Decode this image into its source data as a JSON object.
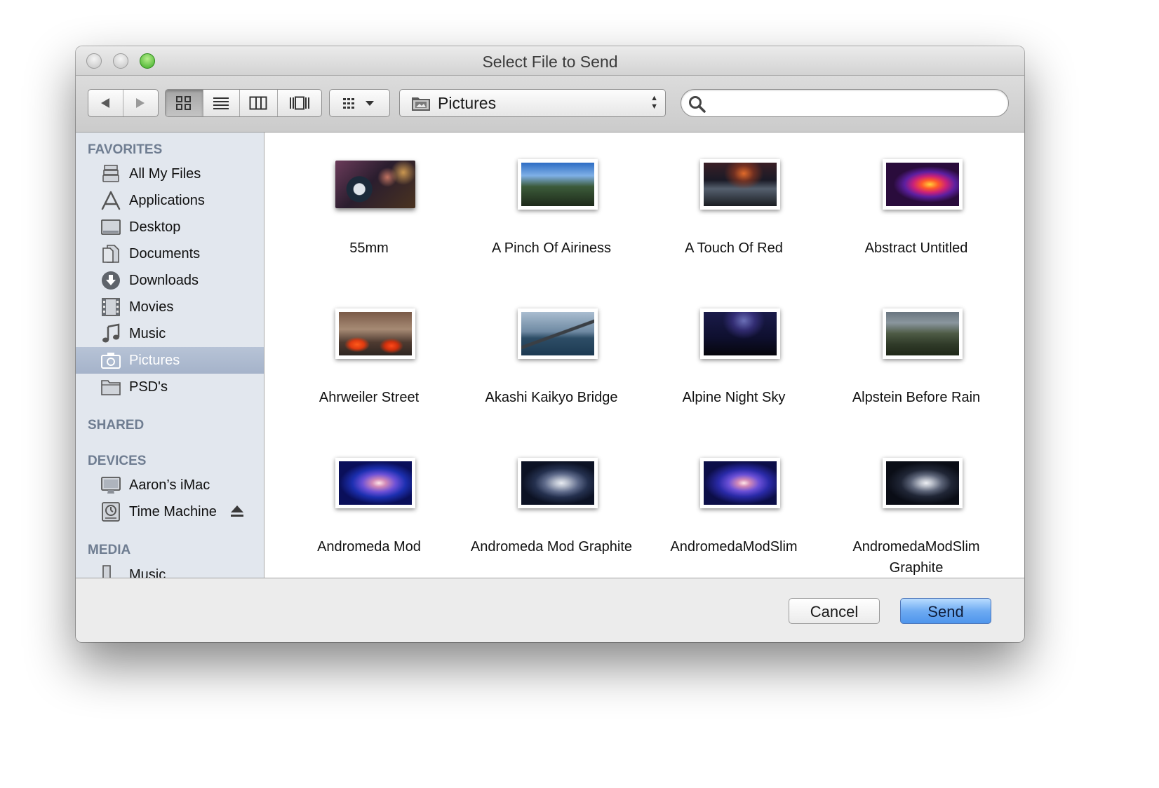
{
  "window": {
    "title": "Select File to Send"
  },
  "toolbar": {
    "back_icon": "back-arrow-icon",
    "forward_icon": "forward-arrow-icon",
    "view_modes": [
      "icon-view",
      "list-view",
      "column-view",
      "cover-flow-view"
    ],
    "active_view": "icon-view",
    "arrange_icon": "arrange-grid-icon",
    "location": "Pictures",
    "search": {
      "value": "",
      "placeholder": ""
    }
  },
  "sidebar": {
    "favorites_header": "FAVORITES",
    "favorites": [
      {
        "label": "All My Files",
        "icon": "all-my-files-icon"
      },
      {
        "label": "Applications",
        "icon": "applications-icon"
      },
      {
        "label": "Desktop",
        "icon": "desktop-icon"
      },
      {
        "label": "Documents",
        "icon": "documents-icon"
      },
      {
        "label": "Downloads",
        "icon": "downloads-icon"
      },
      {
        "label": "Movies",
        "icon": "movies-icon"
      },
      {
        "label": "Music",
        "icon": "music-icon"
      },
      {
        "label": "Pictures",
        "icon": "pictures-icon",
        "selected": true
      },
      {
        "label": "PSD's",
        "icon": "folder-icon"
      }
    ],
    "shared_header": "SHARED",
    "devices_header": "DEVICES",
    "devices": [
      {
        "label": "Aaron’s iMac",
        "icon": "imac-icon"
      },
      {
        "label": "Time Machine",
        "icon": "time-machine-icon",
        "ejectable": true
      }
    ],
    "media_header": "MEDIA",
    "media": [
      {
        "label": "Music",
        "icon": "music-folder-icon"
      }
    ]
  },
  "files": [
    {
      "name": "55mm"
    },
    {
      "name": "A Pinch Of Airiness"
    },
    {
      "name": "A Touch Of Red"
    },
    {
      "name": "Abstract Untitled"
    },
    {
      "name": "Ahrweiler Street"
    },
    {
      "name": "Akashi Kaikyo Bridge"
    },
    {
      "name": "Alpine Night Sky"
    },
    {
      "name": "Alpstein Before Rain"
    },
    {
      "name": "Andromeda Mod"
    },
    {
      "name": "Andromeda Mod Graphite"
    },
    {
      "name": "AndromedaModSlim"
    },
    {
      "name": "AndromedaModSlim Graphite"
    }
  ],
  "buttons": {
    "cancel": "Cancel",
    "send": "Send"
  },
  "colors": {
    "sidebar_bg": "#e2e7ee",
    "section_header": "#6f7d91",
    "selection": "#a5b3ca",
    "default_button": "#4e95ec",
    "zoom_button": "#3cac25"
  }
}
